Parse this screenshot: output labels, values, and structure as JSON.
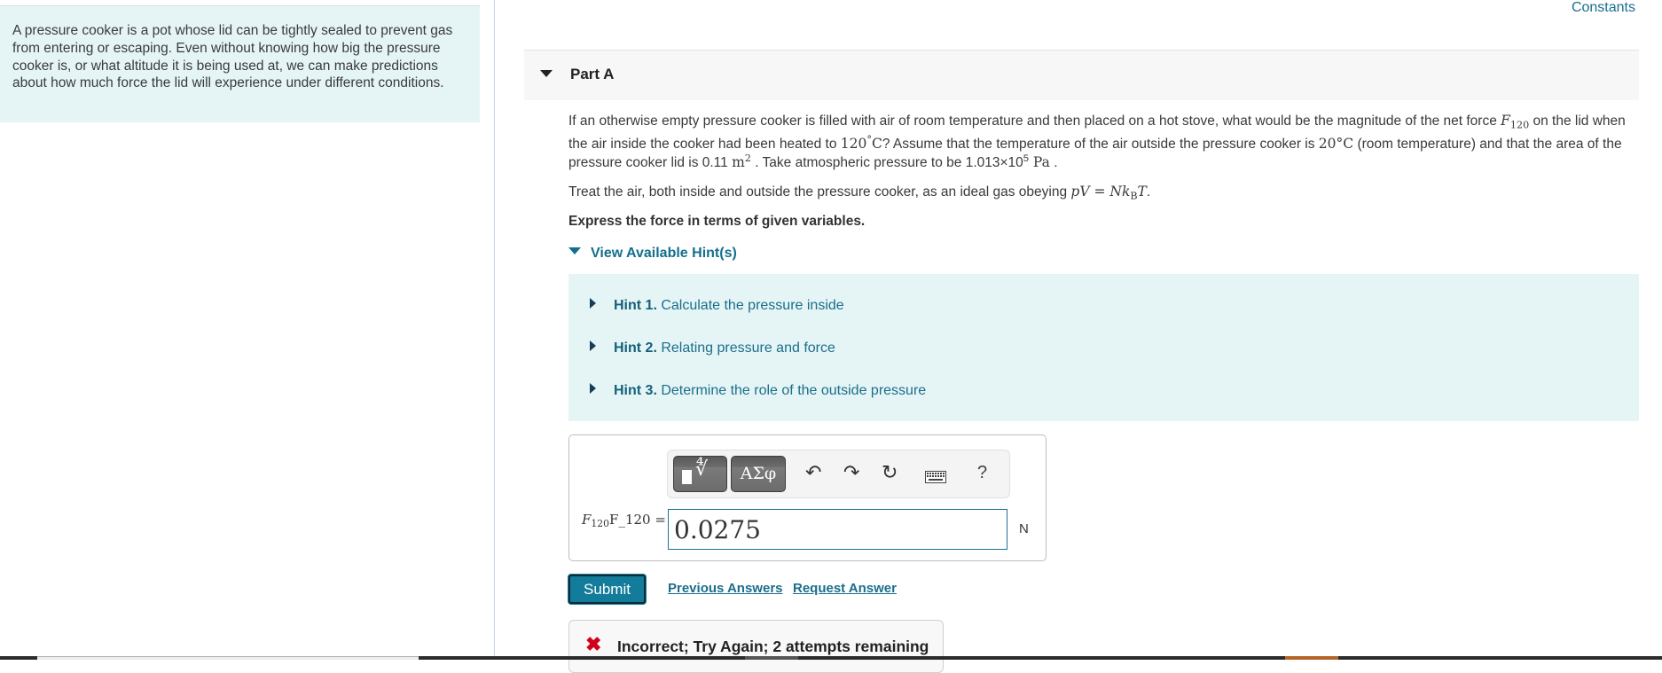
{
  "intro": {
    "text": "A pressure cooker is a pot whose lid can be tightly sealed to prevent gas from entering or escaping. Even without knowing how big the pressure cooker is, or what altitude it is being used at, we can make predictions about how much force the lid will experience under different conditions."
  },
  "header": {
    "constants_link": "Constants"
  },
  "part": {
    "title": "Part A",
    "question": {
      "t1": "If an otherwise empty pressure cooker is filled with air of room temperature and then placed on a hot stove, what would be the magnitude of the net force ",
      "F": "F",
      "F_sub": "120",
      "t2": " on the lid when the air inside the cooker had been heated to ",
      "temp_in": "120",
      "deg": "°",
      "C": "C",
      "t3": "? Assume that the temperature of the air outside the pressure cooker is ",
      "temp_out": "20",
      "deg_C": "°C",
      "t4": " (room temperature) and that the area of the pressure cooker lid is 0.11 ",
      "area_unit": "m",
      "area_exp": "2",
      "t5": " . Take atmospheric pressure to be 1.013×10",
      "p_exp": "5",
      "p_unit": " Pa",
      "t6": " ."
    },
    "ideal_gas": {
      "t1": "Treat the air, both inside and outside the pressure cooker, as an ideal gas obeying ",
      "eq_lhs": "pV",
      "eq_eq": " = ",
      "eq_N": "Nk",
      "eq_sub": "B",
      "eq_T": "T",
      "t2": "."
    },
    "instruction": "Express the force in terms of given variables.",
    "hints_toggle": "View Available Hint(s)",
    "hints": [
      {
        "label": "Hint 1.",
        "text": " Calculate the pressure inside"
      },
      {
        "label": "Hint 2.",
        "text": " Relating pressure and force"
      },
      {
        "label": "Hint 3.",
        "text": " Determine the role of the outside pressure"
      }
    ],
    "answer": {
      "toolbar": {
        "templates_icon": "templates-icon",
        "greek_label": "ΑΣφ",
        "undo_icon": "undo-icon",
        "redo_icon": "redo-icon",
        "reset_icon": "reset-icon",
        "keyboard_icon": "keyboard-icon",
        "help_label": "?"
      },
      "var_symbol": "F",
      "var_sub": "120",
      "var_text": "F_120 =",
      "value": "0.0275",
      "unit": "N"
    },
    "submit_label": "Submit",
    "previous_answers_link": "Previous Answers",
    "request_answer_link": "Request Answer",
    "feedback": {
      "status": "incorrect",
      "message": "Incorrect; Try Again; 2 attempts remaining",
      "color": "#d0021b"
    }
  }
}
